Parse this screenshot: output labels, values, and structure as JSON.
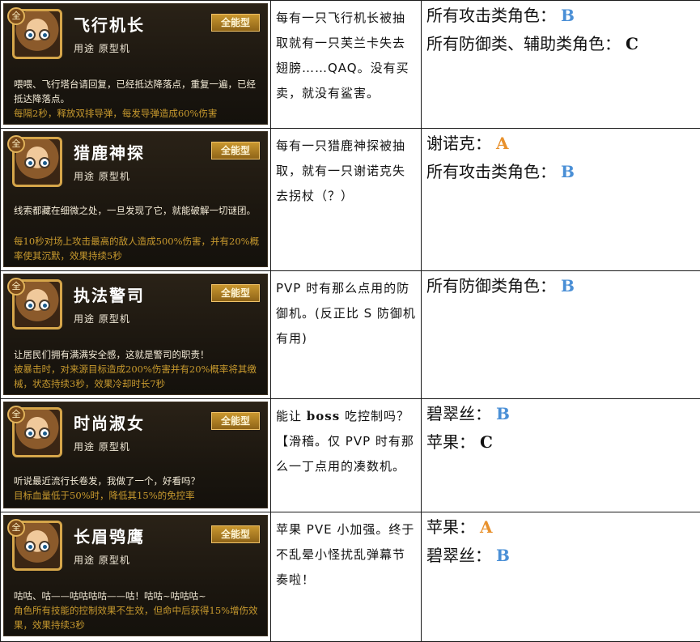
{
  "rows": [
    {
      "card": {
        "badge": "全",
        "name": "飞行机长",
        "type": "全能型",
        "usage": "用途  原型机",
        "desc": "喂喂、飞行塔台请回复，已经抵达降落点，重复一遍，已经抵达降落点。",
        "effect": "每隔2秒，释放双排导弹，每发导弹造成60%伤害"
      },
      "note": "每有一只飞行机长被抽取就有一只芙兰卡失去翅膀……QAQ。没有买卖，就没有鲨害。",
      "ratings": [
        {
          "label": "所有攻击类角色：",
          "grade": "B",
          "color": "#4a8fd6"
        },
        {
          "label": "所有防御类、辅助类角色：",
          "grade": "C",
          "color": "#111111"
        }
      ]
    },
    {
      "card": {
        "badge": "全",
        "name": "猎鹿神探",
        "type": "全能型",
        "usage": "用途  原型机",
        "desc": "线索都藏在细微之处，一旦发现了它，就能破解一切谜团。",
        "effect": "每10秒对场上攻击最高的敌人造成500%伤害，并有20%概率使其沉默，效果持续5秒"
      },
      "note": "每有一只猎鹿神探被抽取，就有一只谢诺克失去拐杖（？）",
      "ratings": [
        {
          "label": "谢诺克：",
          "grade": "A",
          "color": "#e8912d"
        },
        {
          "label": "所有攻击类角色：",
          "grade": "B",
          "color": "#4a8fd6"
        }
      ]
    },
    {
      "card": {
        "badge": "全",
        "name": "执法警司",
        "type": "全能型",
        "usage": "用途  原型机",
        "desc": "让居民们拥有满满安全感，这就是警司的职责！",
        "effect": "被暴击时，对来源目标造成200%伤害并有20%概率将其缴械，状态持续3秒，效果冷却时长7秒"
      },
      "note": "PVP 时有那么点用的防御机。(反正比 S 防御机有用)",
      "ratings": [
        {
          "label": "所有防御类角色：",
          "grade": "B",
          "color": "#4a8fd6"
        }
      ]
    },
    {
      "card": {
        "badge": "全",
        "name": "时尚淑女",
        "type": "全能型",
        "usage": "用途  原型机",
        "desc": "听说最近流行长卷发，我做了一个，好看吗？",
        "effect": "目标血量低于50%时，降低其15%的免控率"
      },
      "note_parts": [
        "能让 ",
        "boss",
        " 吃控制吗？【滑稽。仅 PVP 时有那么一丁点用的凑数机。"
      ],
      "ratings": [
        {
          "label": "碧翠丝：",
          "grade": "B",
          "color": "#4a8fd6"
        },
        {
          "label": "苹果：",
          "grade": "C",
          "color": "#111111"
        }
      ]
    },
    {
      "card": {
        "badge": "全",
        "name": "长眉鸮鹰",
        "type": "全能型",
        "usage": "用途  原型机",
        "desc": "咕咕、咕——咕咕咕咕——咕！咕咕~咕咕咕~",
        "effect": "角色所有技能的控制效果不生效，但命中后获得15%增伤效果，效果持续3秒"
      },
      "note": "苹果 PVE 小加强。终于不乱晕小怪扰乱弹幕节奏啦！",
      "ratings": [
        {
          "label": "苹果：",
          "grade": "A",
          "color": "#e8912d"
        },
        {
          "label": "碧翠丝：",
          "grade": "B",
          "color": "#4a8fd6"
        }
      ]
    }
  ]
}
